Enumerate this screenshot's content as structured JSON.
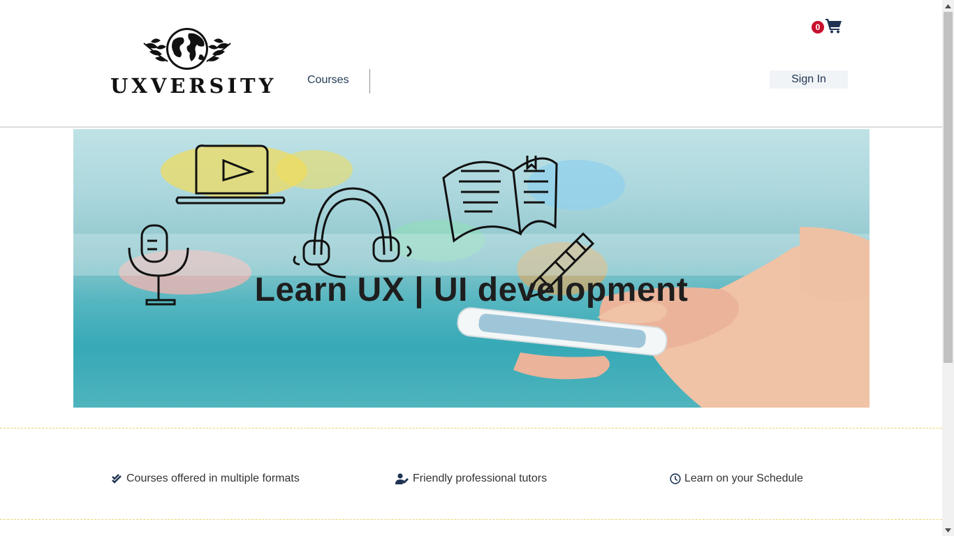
{
  "header": {
    "logo_text": "UXVERSITY",
    "nav_courses": "Courses",
    "cart_count": "0",
    "signin_label": "Sign In"
  },
  "hero": {
    "title": "Learn UX | UI development"
  },
  "features": [
    {
      "icon": "double-check-icon",
      "label": "Courses offered in multiple formats"
    },
    {
      "icon": "user-edit-icon",
      "label": "Friendly professional tutors"
    },
    {
      "icon": "clock-icon",
      "label": "Learn on your Schedule"
    }
  ],
  "colors": {
    "brand_dark": "#1f3452",
    "badge_red": "#c8102e",
    "divider_yellow": "#e9d36a"
  }
}
